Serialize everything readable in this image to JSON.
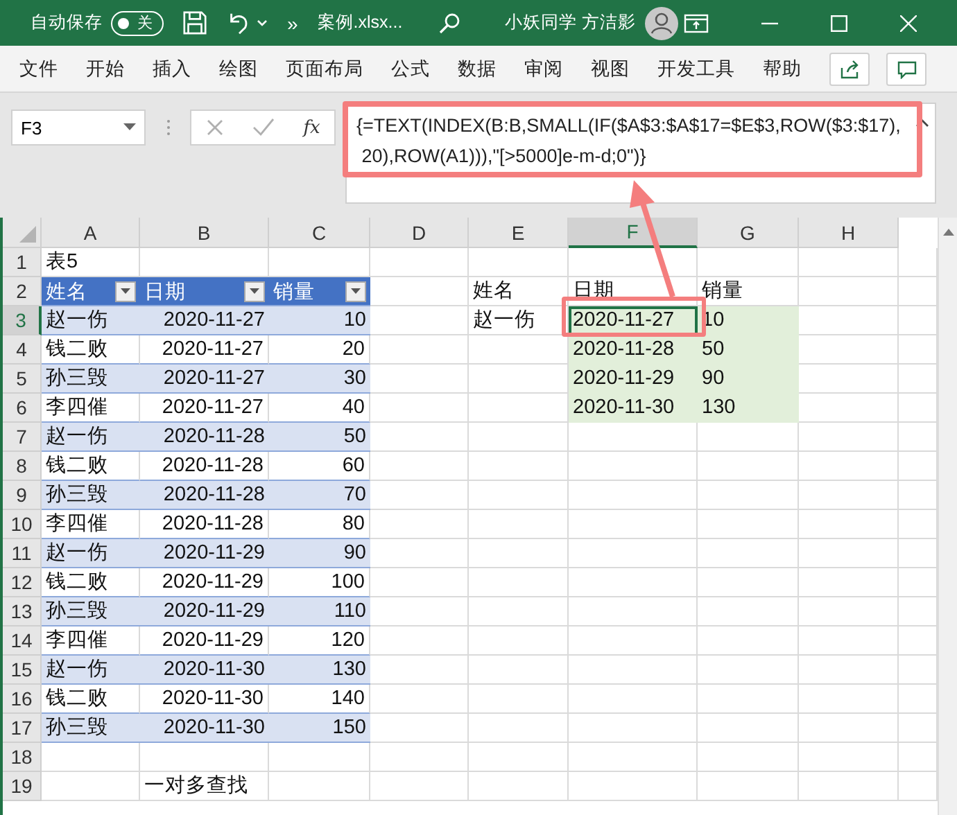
{
  "title_bar": {
    "autosave_label": "自动保存",
    "autosave_toggle": {
      "label": "关",
      "on": false
    },
    "overflow": "»",
    "filename": "案例.xlsx...",
    "user_name": "小妖同学 方洁影"
  },
  "ribbon": {
    "tabs": [
      {
        "label": "文件",
        "selected": false
      },
      {
        "label": "开始",
        "selected": false
      },
      {
        "label": "插入",
        "selected": false
      },
      {
        "label": "绘图",
        "selected": false
      },
      {
        "label": "页面布局",
        "selected": false
      },
      {
        "label": "公式",
        "selected": false
      },
      {
        "label": "数据",
        "selected": false
      },
      {
        "label": "审阅",
        "selected": false
      },
      {
        "label": "视图",
        "selected": false
      },
      {
        "label": "开发工具",
        "selected": false
      },
      {
        "label": "帮助",
        "selected": false
      }
    ]
  },
  "formula_bar": {
    "name_box": "F3",
    "function_label": "fx",
    "formula_lines": [
      "{=TEXT(INDEX(B:B,SMALL(IF($A$3:$A$17=$E$3,ROW($3:$17),",
      " 20),ROW(A1))),\"[>5000]e-m-d;0\")}"
    ]
  },
  "sheet": {
    "columns": [
      "A",
      "B",
      "C",
      "D",
      "E",
      "F",
      "G",
      "H"
    ],
    "row_numbers": [
      "1",
      "2",
      "3",
      "4",
      "5",
      "6",
      "7",
      "8",
      "9",
      "10",
      "11",
      "12",
      "13",
      "14",
      "15",
      "16",
      "17",
      "18",
      "19"
    ],
    "title_cell": "表5",
    "table": {
      "columns": [
        "姓名",
        "日期",
        "销量"
      ],
      "rows": [
        [
          "赵一伤",
          "2020-11-27",
          "10"
        ],
        [
          "钱二败",
          "2020-11-27",
          "20"
        ],
        [
          "孙三毁",
          "2020-11-27",
          "30"
        ],
        [
          "李四催",
          "2020-11-27",
          "40"
        ],
        [
          "赵一伤",
          "2020-11-28",
          "50"
        ],
        [
          "钱二败",
          "2020-11-28",
          "60"
        ],
        [
          "孙三毁",
          "2020-11-28",
          "70"
        ],
        [
          "李四催",
          "2020-11-28",
          "80"
        ],
        [
          "赵一伤",
          "2020-11-29",
          "90"
        ],
        [
          "钱二败",
          "2020-11-29",
          "100"
        ],
        [
          "孙三毁",
          "2020-11-29",
          "110"
        ],
        [
          "李四催",
          "2020-11-29",
          "120"
        ],
        [
          "赵一伤",
          "2020-11-30",
          "130"
        ],
        [
          "钱二败",
          "2020-11-30",
          "140"
        ],
        [
          "孙三毁",
          "2020-11-30",
          "150"
        ]
      ]
    },
    "lookup": {
      "labels": [
        "姓名",
        "日期",
        "销量"
      ],
      "name": "赵一伤",
      "results": [
        {
          "date": "2020-11-27",
          "sales": "10",
          "selected": true
        },
        {
          "date": "2020-11-28",
          "sales": "50",
          "selected": false
        },
        {
          "date": "2020-11-29",
          "sales": "90",
          "selected": false
        },
        {
          "date": "2020-11-30",
          "sales": "130",
          "selected": false
        }
      ]
    },
    "note": "一对多查找"
  }
}
